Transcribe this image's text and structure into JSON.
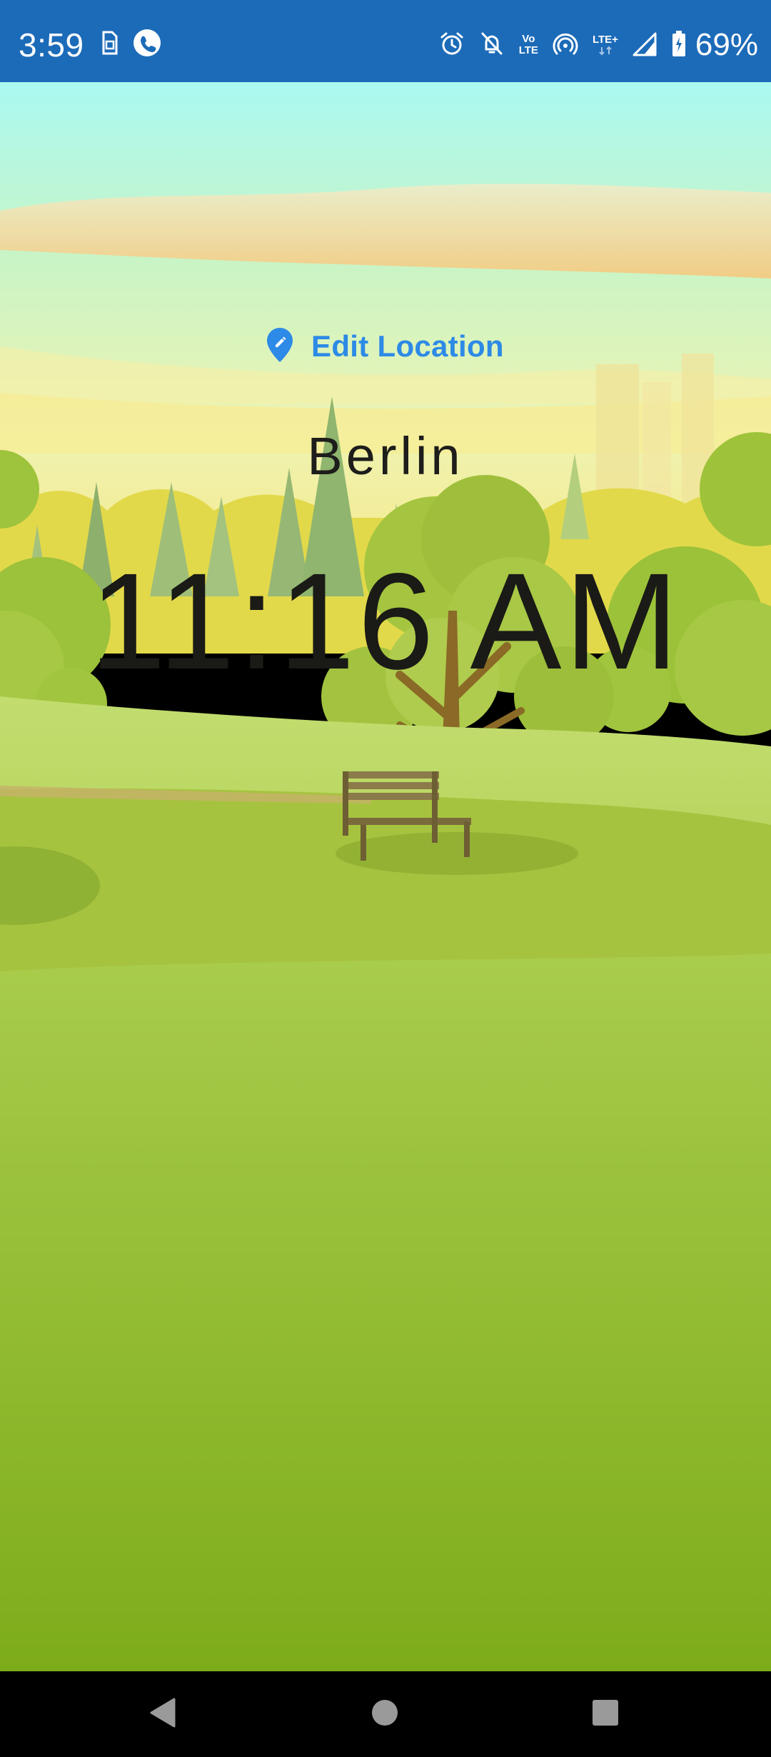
{
  "status_bar": {
    "time": "3:59",
    "battery_percent": "69%",
    "volte_label_top": "Vo",
    "volte_label_bottom": "LTE",
    "lte_label": "LTE+",
    "icons_left": [
      "sim-icon",
      "phone-call-icon"
    ],
    "icons_right": [
      "alarm-icon",
      "bell-off-icon",
      "volte-icon",
      "hotspot-icon",
      "lte-icon",
      "signal-icon",
      "battery-icon"
    ],
    "background_color": "#1c6bb8"
  },
  "main": {
    "edit_location_label": "Edit Location",
    "edit_location_icon": "edit-location-pin-icon",
    "accent_color": "#2d8ae6",
    "location": "Berlin",
    "time": "11:16 AM",
    "background": "day-park-illustration"
  },
  "nav_bar": {
    "buttons": [
      "back-icon",
      "home-icon",
      "recents-icon"
    ]
  }
}
